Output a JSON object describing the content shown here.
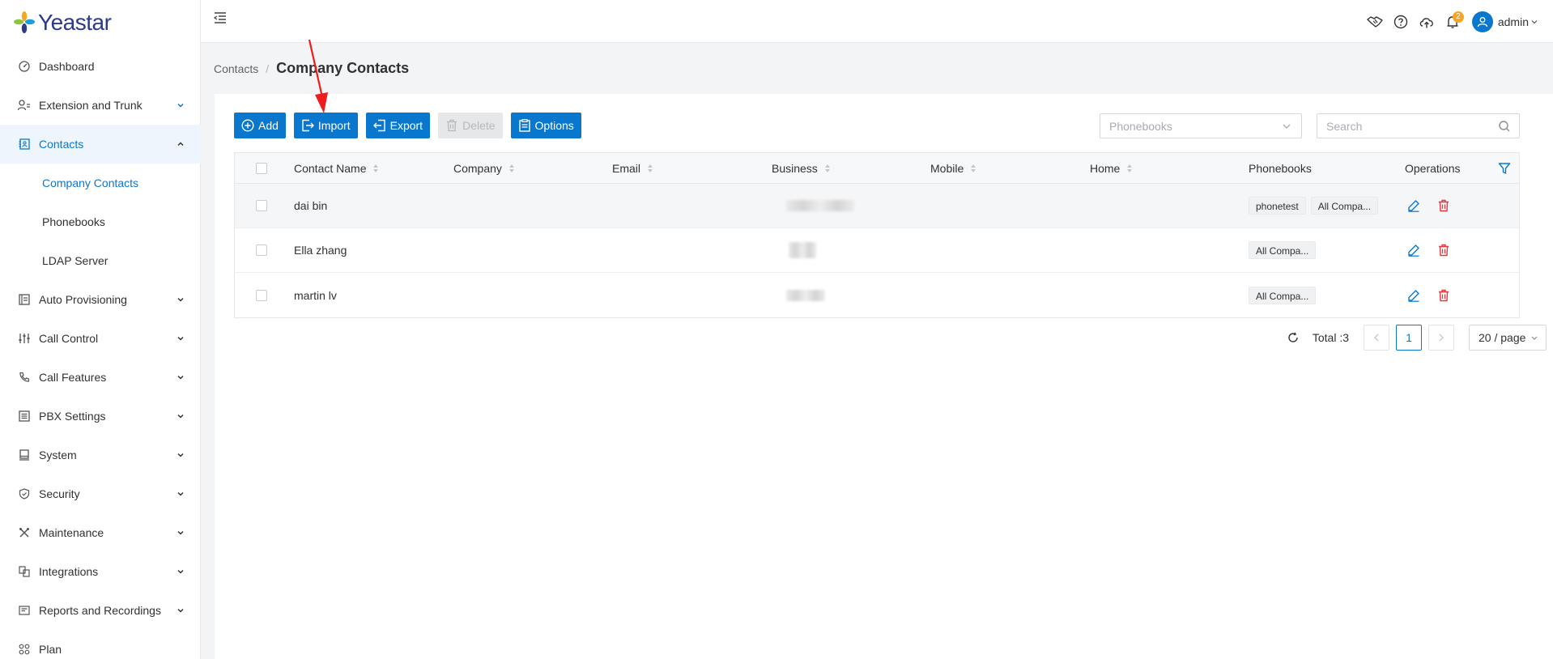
{
  "app": {
    "logo_text": "Yeastar"
  },
  "sidebar": {
    "items": [
      {
        "label": "Dashboard",
        "icon": "dashboard-icon",
        "expandable": false
      },
      {
        "label": "Extension and Trunk",
        "icon": "user-icon",
        "expandable": true,
        "accent_chevron": true
      },
      {
        "label": "Contacts",
        "icon": "contacts-icon",
        "expandable": true,
        "active": true
      },
      {
        "label": "Auto Provisioning",
        "icon": "provisioning-icon",
        "expandable": true
      },
      {
        "label": "Call Control",
        "icon": "sliders-icon",
        "expandable": true
      },
      {
        "label": "Call Features",
        "icon": "phone-icon",
        "expandable": true
      },
      {
        "label": "PBX Settings",
        "icon": "list-icon",
        "expandable": true
      },
      {
        "label": "System",
        "icon": "monitor-icon",
        "expandable": true
      },
      {
        "label": "Security",
        "icon": "shield-icon",
        "expandable": true
      },
      {
        "label": "Maintenance",
        "icon": "tools-icon",
        "expandable": true
      },
      {
        "label": "Integrations",
        "icon": "integrations-icon",
        "expandable": true
      },
      {
        "label": "Reports and Recordings",
        "icon": "reports-icon",
        "expandable": true
      },
      {
        "label": "Plan",
        "icon": "plan-icon",
        "expandable": false
      }
    ],
    "contacts_submenu": [
      {
        "label": "Company Contacts",
        "selected": true
      },
      {
        "label": "Phonebooks",
        "selected": false
      },
      {
        "label": "LDAP Server",
        "selected": false
      }
    ]
  },
  "header": {
    "notification_count": "2",
    "username": "admin"
  },
  "breadcrumb": {
    "parent": "Contacts",
    "separator": "/",
    "current": "Company Contacts"
  },
  "toolbar": {
    "add_label": "Add",
    "import_label": "Import",
    "export_label": "Export",
    "delete_label": "Delete",
    "options_label": "Options"
  },
  "filters": {
    "phonebooks_placeholder": "Phonebooks",
    "search_placeholder": "Search"
  },
  "table": {
    "columns": {
      "contact_name": "Contact Name",
      "company": "Company",
      "email": "Email",
      "business": "Business",
      "mobile": "Mobile",
      "home": "Home",
      "phonebooks": "Phonebooks",
      "operations": "Operations"
    },
    "rows": [
      {
        "name": "dai bin",
        "phonebooks": [
          "phonetest",
          "All Compa..."
        ]
      },
      {
        "name": "Ella zhang",
        "phonebooks": [
          "All Compa..."
        ]
      },
      {
        "name": "martin lv",
        "phonebooks": [
          "All Compa..."
        ]
      }
    ]
  },
  "pagination": {
    "total_label": "Total :3",
    "current_page": "1",
    "page_size": "20 / page"
  },
  "colors": {
    "primary": "#0a77cf",
    "danger": "#e0393e",
    "badge": "#f5a623",
    "annotation": "#ee1c1c"
  }
}
